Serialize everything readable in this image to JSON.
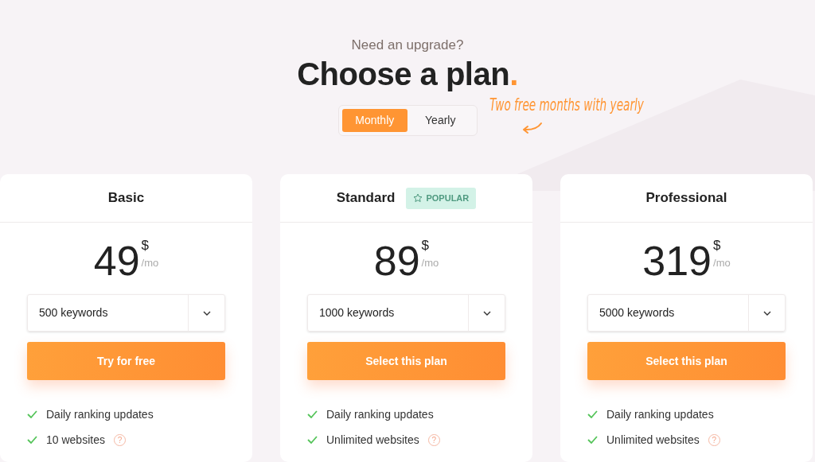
{
  "header": {
    "subtitle": "Need an upgrade?",
    "title": "Choose a plan",
    "title_mark": "."
  },
  "billing_toggle": [
    {
      "label": "Monthly",
      "selected": true
    },
    {
      "label": "Yearly",
      "selected": false
    }
  ],
  "annotation": "Two free months with yearly",
  "plans": [
    {
      "name": "Basic",
      "price": "49",
      "currency": "$",
      "period": "/mo",
      "keywords": "500 keywords",
      "button": "Try for free",
      "features": [
        {
          "text": "Daily ranking updates"
        },
        {
          "text": "10 websites",
          "help": "?"
        }
      ]
    },
    {
      "name": "Standard",
      "badge": "POPULAR",
      "price": "89",
      "currency": "$",
      "period": "/mo",
      "keywords": "1000 keywords",
      "button": "Select this plan",
      "features": [
        {
          "text": "Daily ranking updates"
        },
        {
          "text": "Unlimited websites",
          "help": "?"
        }
      ]
    },
    {
      "name": "Professional",
      "price": "319",
      "currency": "$",
      "period": "/mo",
      "keywords": "5000 keywords",
      "button": "Select this plan",
      "features": [
        {
          "text": "Daily ranking updates"
        },
        {
          "text": "Unlimited websites",
          "help": "?"
        }
      ]
    }
  ]
}
